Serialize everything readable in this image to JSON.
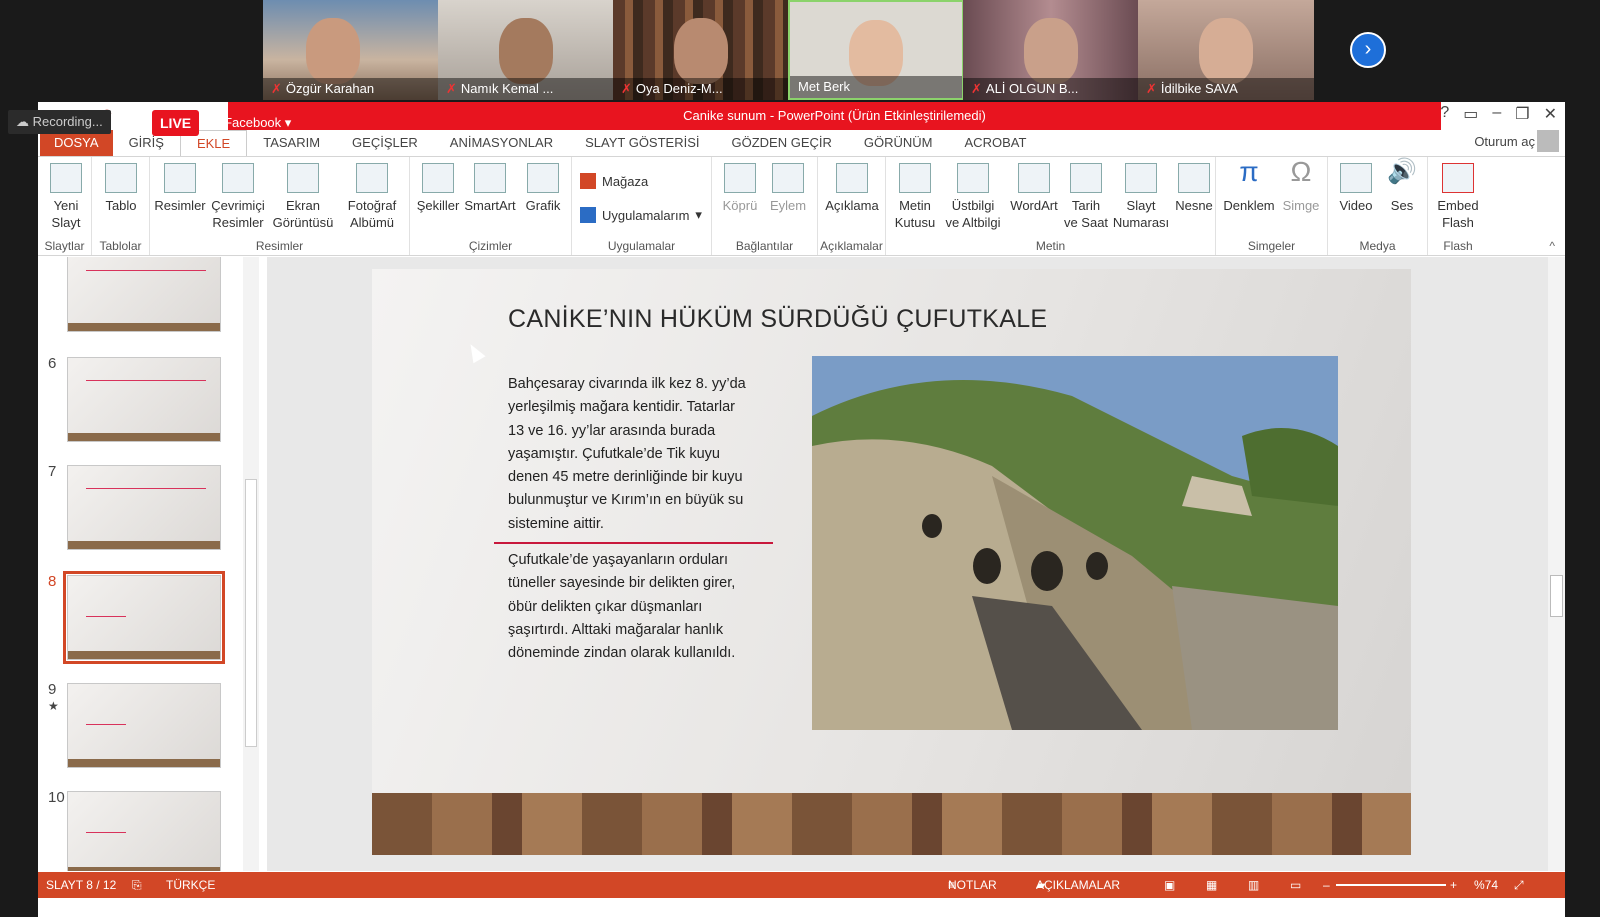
{
  "participants": [
    {
      "name": "Özgür Karahan",
      "muted": true
    },
    {
      "name": "Namık Kemal ...",
      "muted": true
    },
    {
      "name": "Oya Deniz-M...",
      "muted": true
    },
    {
      "name": "Met Berk",
      "muted": false
    },
    {
      "name": "ALİ OLGUN B...",
      "muted": true
    },
    {
      "name": "İdilbike SAVA",
      "muted": true
    }
  ],
  "recording": {
    "label": "Recording...",
    "live": "LIVE",
    "destination": "on Facebook"
  },
  "window": {
    "title": "Canike sunum  -  PowerPoint (Ürün Etkinleştirilemedi)",
    "signin": "Oturum aç"
  },
  "tabs": [
    "DOSYA",
    "GİRİŞ",
    "EKLE",
    "TASARIM",
    "GEÇİŞLER",
    "ANİMASYONLAR",
    "SLAYT GÖSTERİSİ",
    "GÖZDEN GEÇİR",
    "GÖRÜNÜM",
    "ACROBAT"
  ],
  "active_tab": "EKLE",
  "ribbon": {
    "yeni_slayt": "Yeni\nSlayt",
    "tablo": "Tablo",
    "resimler": "Resimler",
    "cevrimici": "Çevrimiçi\nResimler",
    "ekran": "Ekran\nGörüntüsü",
    "fotograf": "Fotoğraf\nAlbümü",
    "sekiller": "Şekiller",
    "smartart": "SmartArt",
    "grafik": "Grafik",
    "magaza": "Mağaza",
    "uygulamalarim": "Uygulamalarım",
    "kopru": "Köprü",
    "eylem": "Eylem",
    "aciklama": "Açıklama",
    "metin_kutusu": "Metin\nKutusu",
    "ustbilgi": "Üstbilgi\nve Altbilgi",
    "wordart": "WordArt",
    "tarih": "Tarih\nve Saat",
    "slayt_no": "Slayt\nNumarası",
    "nesne": "Nesne",
    "denklem": "Denklem",
    "simge": "Simge",
    "video": "Video",
    "ses": "Ses",
    "embed": "Embed\nFlash",
    "groups": {
      "slaytlar": "Slaytlar",
      "tablolar": "Tablolar",
      "resimler": "Resimler",
      "cizimler": "Çizimler",
      "uygulamalar": "Uygulamalar",
      "baglantilar": "Bağlantılar",
      "aciklamalar": "Açıklamalar",
      "metin": "Metin",
      "simgeler": "Simgeler",
      "medya": "Medya",
      "flash": "Flash"
    }
  },
  "thumbnails": [
    {
      "n": "6"
    },
    {
      "n": "7"
    },
    {
      "n": "8"
    },
    {
      "n": "9"
    },
    {
      "n": "10"
    }
  ],
  "slide": {
    "title": "CANİKE’NIN HÜKÜM SÜRDÜĞÜ ÇUFUTKALE",
    "paragraph1": "Bahçesaray civarında ilk kez 8. yy’da yerleşilmiş mağara kentidir. Tatarlar 13 ve 16. yy’lar arasında burada yaşamıştır. Çufutkale’de Tik kuyu denen 45 metre derinliğinde bir kuyu bulunmuştur ve Kırım’ın en büyük su sistemine aittir.",
    "paragraph2": "Çufutkale’de yaşayanların orduları tüneller sayesinde bir delikten girer, öbür delikten çıkar düşmanları şaşırtırdı. Alttaki mağaralar hanlık döneminde zindan olarak kullanıldı."
  },
  "status": {
    "slide": "SLAYT 8 / 12",
    "language": "TÜRKÇE",
    "notes": "NOTLAR",
    "comments": "AÇIKLAMALAR",
    "zoom": "%74"
  },
  "colors": {
    "accent": "#d24726",
    "title_red": "#e8141f"
  }
}
